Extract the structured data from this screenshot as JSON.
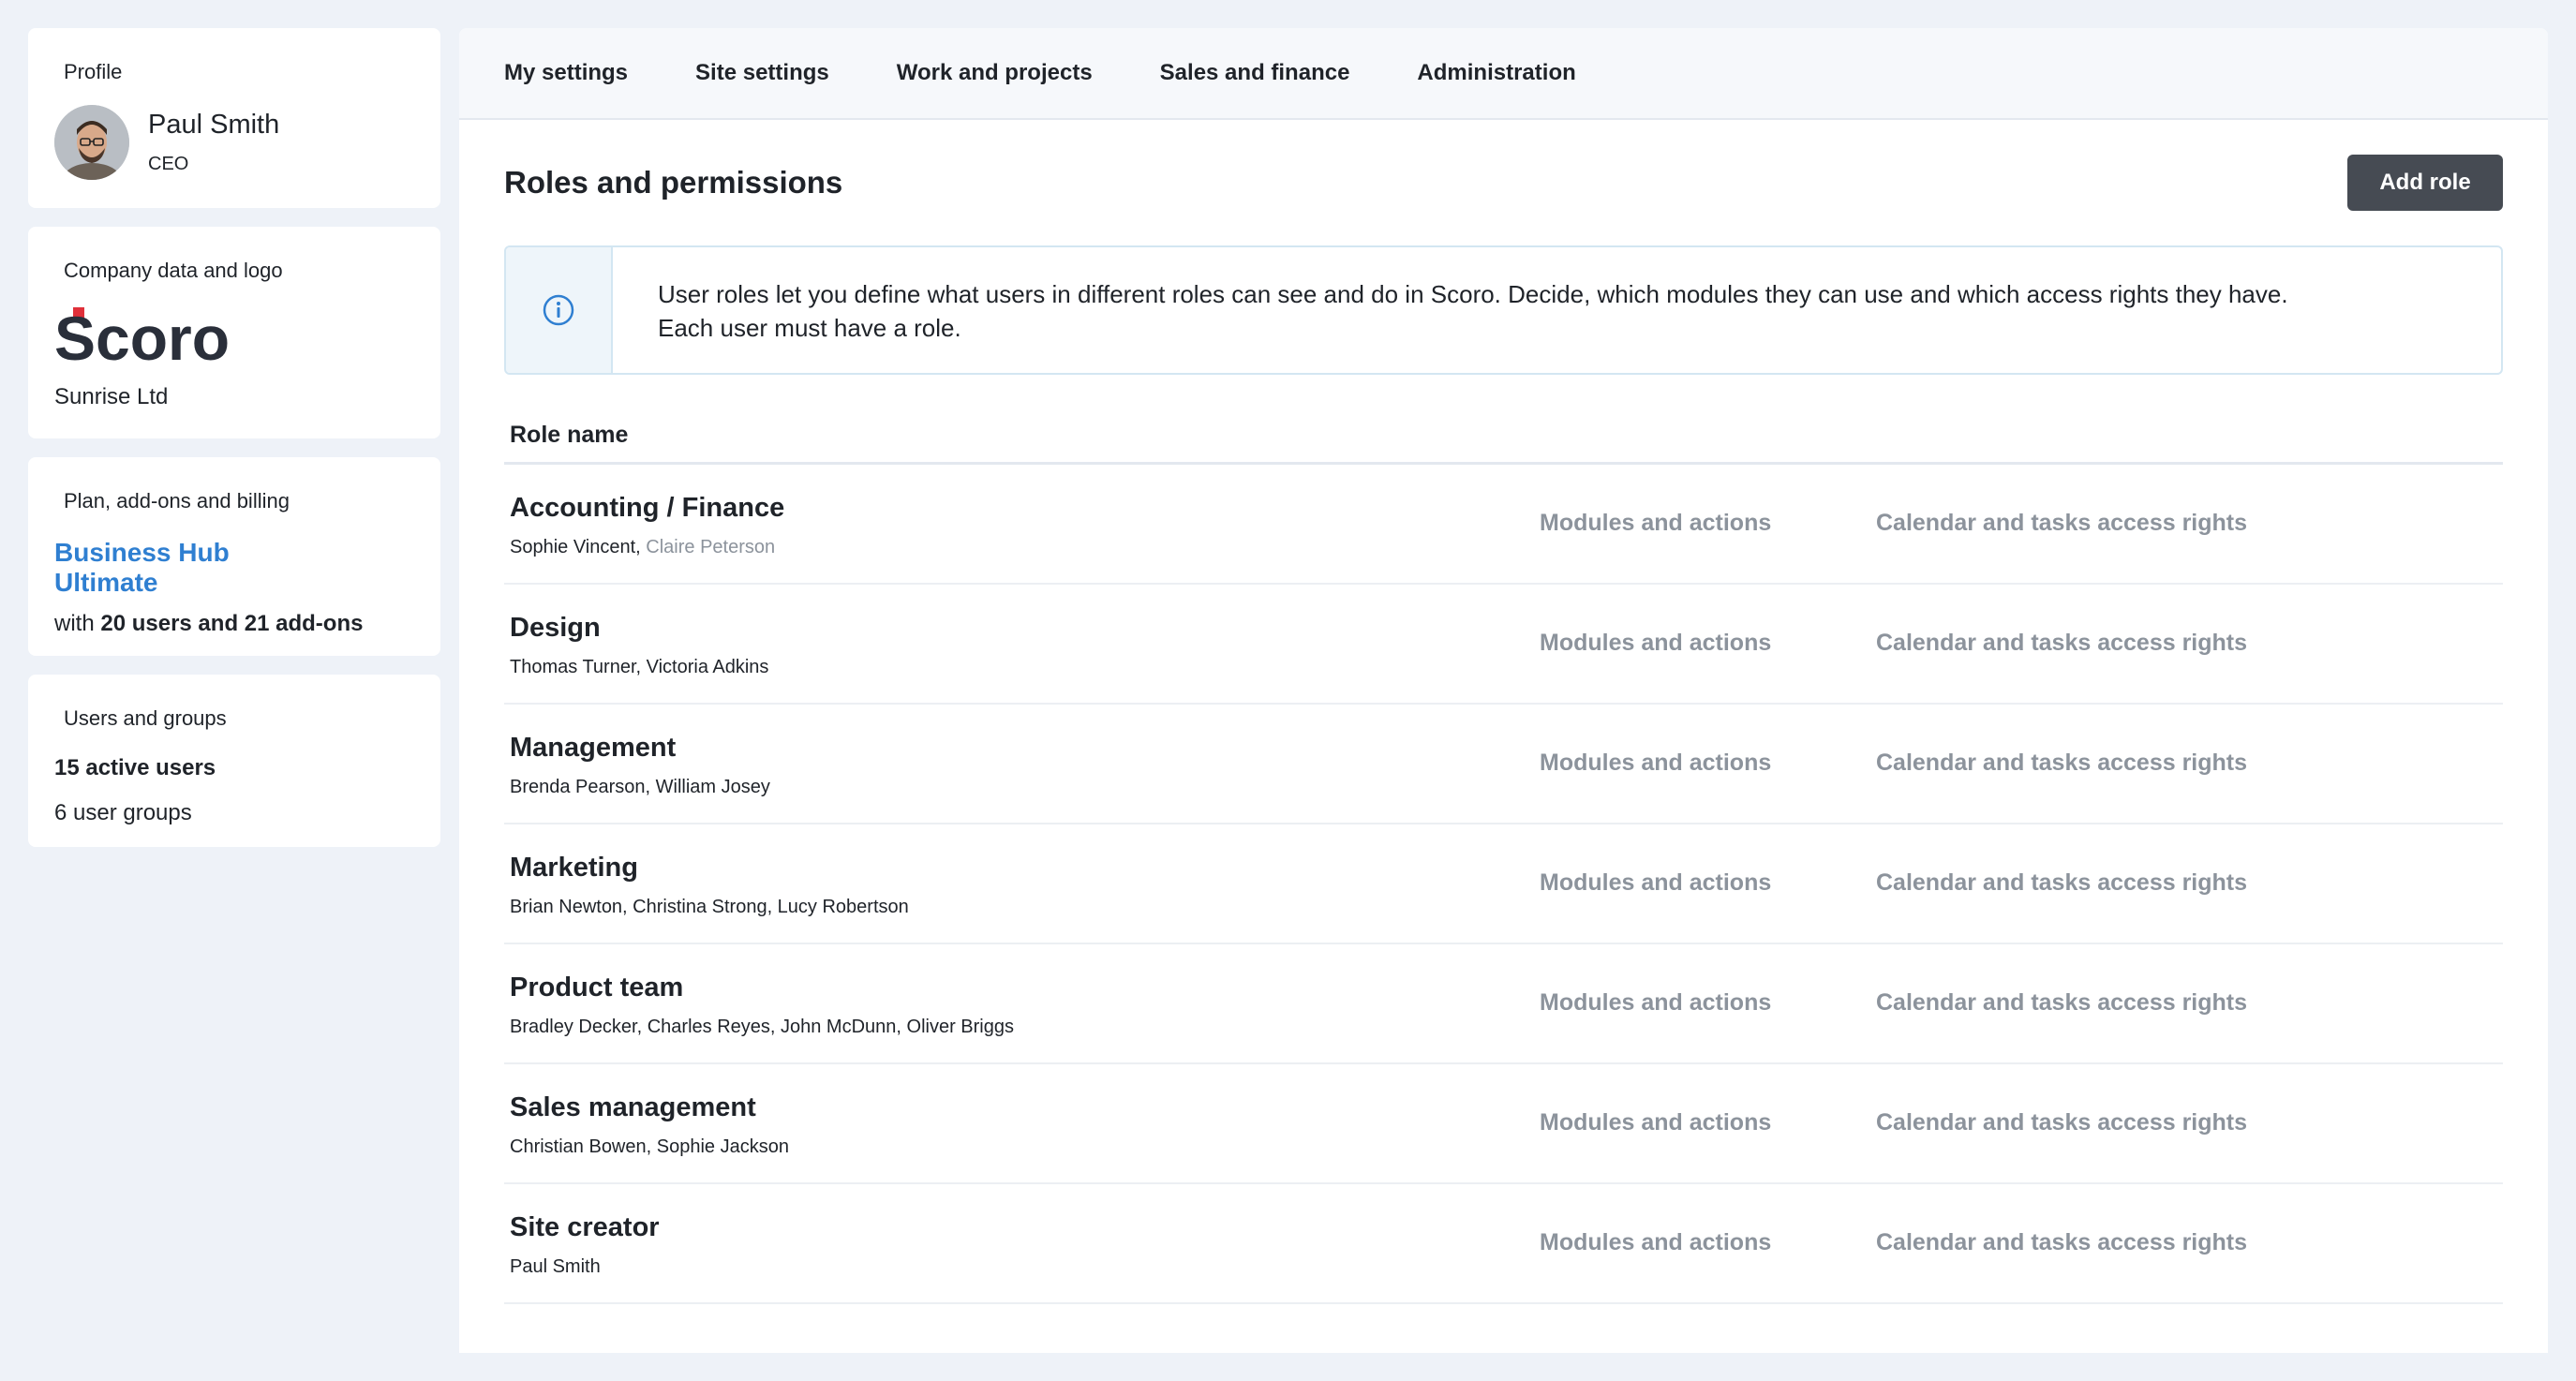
{
  "sidebar": {
    "profile": {
      "title": "Profile",
      "name": "Paul Smith",
      "role": "CEO"
    },
    "company": {
      "title": "Company data and logo",
      "logo_text": "Scoro",
      "name": "Sunrise Ltd"
    },
    "plan": {
      "title": "Plan, add-ons and billing",
      "name_line1": "Business Hub",
      "name_line2": "Ultimate",
      "detail_prefix": "with ",
      "detail_bold": "20 users and 21 add-ons"
    },
    "users": {
      "title": "Users and groups",
      "active": "15 active users",
      "groups": "6 user groups"
    }
  },
  "tabs": [
    {
      "label": "My settings"
    },
    {
      "label": "Site settings"
    },
    {
      "label": "Work and projects"
    },
    {
      "label": "Sales and finance"
    },
    {
      "label": "Administration"
    }
  ],
  "main": {
    "title": "Roles and permissions",
    "add_button": "Add role",
    "info_line1": "User roles let you define what users in different roles can see and do in Scoro. Decide, which modules they can use and which access rights they have.",
    "info_line2": "Each user must have a role.",
    "column_header": "Role name",
    "modules_label": "Modules and actions",
    "calendar_label": "Calendar and tasks access rights"
  },
  "roles": [
    {
      "name": "Accounting / Finance",
      "members": "Sophie Vincent, ",
      "members_muted": "Claire Peterson"
    },
    {
      "name": "Design",
      "members": "Thomas Turner, Victoria Adkins"
    },
    {
      "name": "Management",
      "members": "Brenda Pearson, William Josey"
    },
    {
      "name": "Marketing",
      "members": "Brian Newton, Christina Strong, Lucy Robertson"
    },
    {
      "name": "Product team",
      "members": "Bradley Decker, Charles Reyes, John McDunn, Oliver Briggs"
    },
    {
      "name": "Sales management",
      "members": "Christian Bowen, Sophie Jackson"
    },
    {
      "name": "Site creator",
      "members": "Paul Smith"
    }
  ],
  "colors": {
    "accent": "#2f7fd1",
    "button": "#464b53",
    "logo_red": "#e0303a",
    "logo_dark": "#2a2f3a"
  }
}
